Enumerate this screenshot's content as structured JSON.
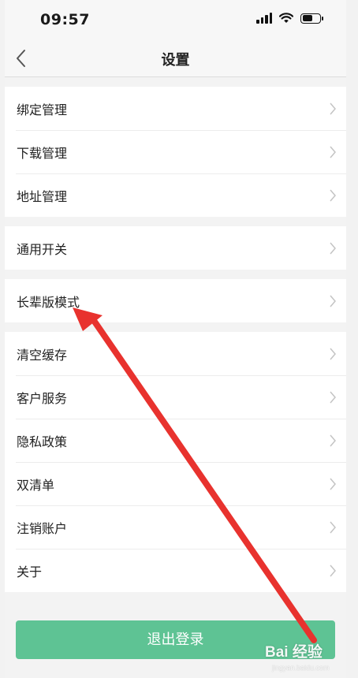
{
  "status_bar": {
    "time": "09:57",
    "battery_level": 0.65
  },
  "nav": {
    "title": "设置",
    "back_icon": "chevron-left-icon"
  },
  "groups": [
    {
      "items": [
        {
          "label": "绑定管理"
        },
        {
          "label": "下载管理"
        },
        {
          "label": "地址管理"
        }
      ]
    },
    {
      "items": [
        {
          "label": "通用开关"
        }
      ]
    },
    {
      "items": [
        {
          "label": "长辈版模式"
        }
      ]
    },
    {
      "items": [
        {
          "label": "清空缓存"
        },
        {
          "label": "客户服务"
        },
        {
          "label": "隐私政策"
        },
        {
          "label": "双清单"
        },
        {
          "label": "注销账户"
        },
        {
          "label": "关于"
        }
      ]
    }
  ],
  "logout": {
    "label": "退出登录"
  },
  "colors": {
    "accent": "#5ec394",
    "annotation_arrow": "#e8322e"
  },
  "watermark": {
    "brand": "Bai 经验",
    "sub": "jingyan.baidu.com"
  }
}
